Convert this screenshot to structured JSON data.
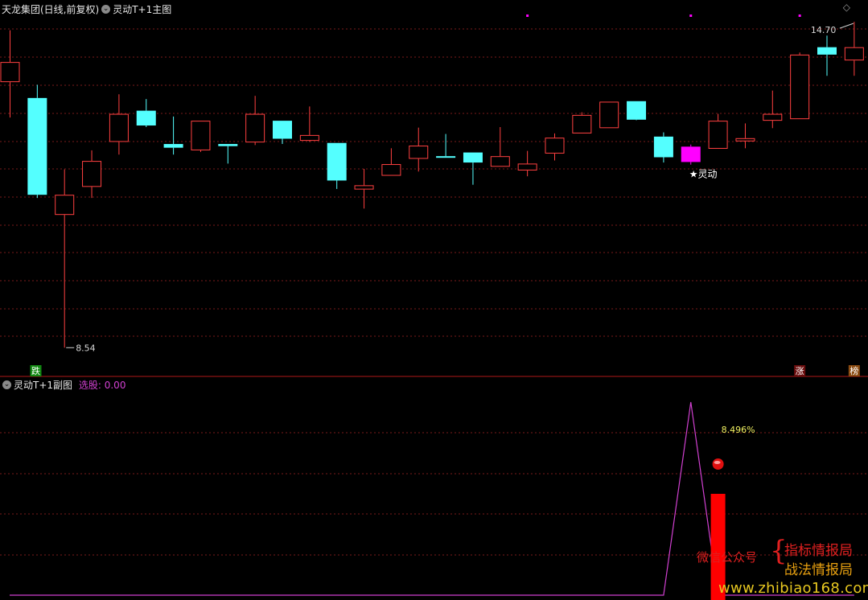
{
  "main_panel": {
    "stock_title": "天龙集团(日线,前复权)",
    "indicator_title": "灵动T+1主图",
    "toggle_icon": "chevron-down-icon",
    "corner_icon": "diamond-icon"
  },
  "sub_panel": {
    "indicator_title": "灵动T+1副图",
    "select_label": "选股:",
    "select_value": "0.00",
    "toggle_icon": "chevron-down-icon"
  },
  "watermark": {
    "left_text": "微信公众号",
    "right_line1": "指标情报局",
    "right_line2": "战法情报局",
    "url": "www.zhibiao168.com"
  },
  "colors": {
    "up": "#ff4040",
    "down": "#54ffff",
    "signal_candle": "#ff00ff",
    "grid": "#7a1a1a",
    "divider": "#b01818",
    "signal_line": "#d040d0",
    "signal_bar": "#ff0000"
  },
  "chart_data": [
    {
      "type": "candlestick",
      "title": "天龙集团(日线,前复权)",
      "price_range": [
        8.24,
        14.93
      ],
      "candles": [
        {
          "o": 13.56,
          "h": 14.54,
          "l": 12.89,
          "c": 13.94,
          "color": "up"
        },
        {
          "o": 13.26,
          "h": 13.51,
          "l": 11.37,
          "c": 11.43,
          "color": "down"
        },
        {
          "o": 11.05,
          "h": 11.91,
          "l": 8.54,
          "c": 11.43,
          "color": "up"
        },
        {
          "o": 11.58,
          "h": 12.27,
          "l": 11.37,
          "c": 12.07,
          "color": "up"
        },
        {
          "o": 12.43,
          "h": 13.33,
          "l": 12.19,
          "c": 12.96,
          "color": "up"
        },
        {
          "o": 12.74,
          "h": 13.24,
          "l": 12.71,
          "c": 13.02,
          "color": "down"
        },
        {
          "o": 12.39,
          "h": 12.91,
          "l": 12.19,
          "c": 12.32,
          "color": "down"
        },
        {
          "o": 12.27,
          "h": 12.64,
          "l": 12.24,
          "c": 12.83,
          "color": "up"
        },
        {
          "o": 12.35,
          "h": 12.37,
          "l": 12.02,
          "c": 12.39,
          "color": "down"
        },
        {
          "o": 12.42,
          "h": 13.3,
          "l": 12.37,
          "c": 12.96,
          "color": "up"
        },
        {
          "o": 12.83,
          "h": 12.82,
          "l": 12.39,
          "c": 12.49,
          "color": "down"
        },
        {
          "o": 12.45,
          "h": 13.1,
          "l": 12.43,
          "c": 12.56,
          "color": "up"
        },
        {
          "o": 12.41,
          "h": 12.34,
          "l": 11.54,
          "c": 11.7,
          "color": "down"
        },
        {
          "o": 11.53,
          "h": 11.92,
          "l": 11.17,
          "c": 11.61,
          "color": "up"
        },
        {
          "o": 11.79,
          "h": 12.31,
          "l": 11.87,
          "c": 12.01,
          "color": "up"
        },
        {
          "o": 12.11,
          "h": 12.7,
          "l": 11.87,
          "c": 12.36,
          "color": "up"
        },
        {
          "o": 12.15,
          "h": 12.58,
          "l": 12.14,
          "c": 12.16,
          "color": "down"
        },
        {
          "o": 12.23,
          "h": 12.16,
          "l": 11.62,
          "c": 12.04,
          "color": "down"
        },
        {
          "o": 11.96,
          "h": 12.71,
          "l": 11.96,
          "c": 12.16,
          "color": "up"
        },
        {
          "o": 12.02,
          "h": 12.26,
          "l": 11.78,
          "c": 11.89,
          "color": "up"
        },
        {
          "o": 12.21,
          "h": 12.59,
          "l": 12.08,
          "c": 12.51,
          "color": "up"
        },
        {
          "o": 12.59,
          "h": 12.99,
          "l": 12.59,
          "c": 12.94,
          "color": "up"
        },
        {
          "o": 12.69,
          "h": 12.93,
          "l": 12.69,
          "c": 13.19,
          "color": "up"
        },
        {
          "o": 13.2,
          "h": 13.11,
          "l": 12.84,
          "c": 12.85,
          "color": "down"
        },
        {
          "o": 12.53,
          "h": 12.61,
          "l": 12.04,
          "c": 12.14,
          "color": "down"
        },
        {
          "o": 12.34,
          "h": 12.38,
          "l": 12.0,
          "c": 12.05,
          "color": "signal"
        },
        {
          "o": 12.3,
          "h": 12.96,
          "l": 12.3,
          "c": 12.83,
          "color": "up"
        },
        {
          "o": 12.44,
          "h": 12.78,
          "l": 12.31,
          "c": 12.5,
          "color": "up"
        },
        {
          "o": 12.83,
          "h": 13.4,
          "l": 12.69,
          "c": 12.96,
          "color": "up"
        },
        {
          "o": 12.86,
          "h": 14.12,
          "l": 12.86,
          "c": 14.08,
          "color": "up"
        },
        {
          "o": 14.08,
          "h": 14.44,
          "l": 13.68,
          "c": 14.22,
          "color": "down"
        },
        {
          "o": 13.97,
          "h": 14.7,
          "l": 13.68,
          "c": 14.22,
          "color": "up"
        }
      ],
      "annotations": {
        "high_label": "14.70",
        "low_label": "8.54",
        "signal_label": "★灵动",
        "bottom_markers": [
          {
            "label": "跌",
            "candle": 0,
            "bg": "#118811"
          },
          {
            "label": "涨",
            "candle": 29,
            "bg": "#6a0d0d"
          },
          {
            "label": "榜",
            "candle": 31,
            "bg": "#8a4a10"
          }
        ],
        "top_markers_at": [
          19,
          25,
          29
        ]
      }
    },
    {
      "type": "line",
      "title": "灵动T+1副图",
      "series": [
        {
          "values": [
            0,
            0,
            0,
            0,
            0,
            0,
            0,
            0,
            0,
            0,
            0,
            0,
            0,
            0,
            0,
            0,
            0,
            0,
            0,
            0,
            0,
            0,
            0,
            0,
            0,
            1,
            0,
            0,
            0,
            0,
            0,
            0
          ]
        }
      ],
      "bar_at": 26,
      "value_label": "8.496%",
      "ylim": [
        0,
        1.05
      ]
    }
  ]
}
